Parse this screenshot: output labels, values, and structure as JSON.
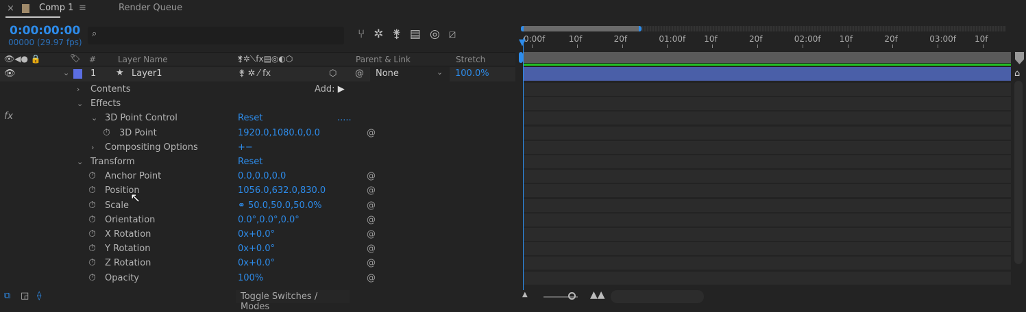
{
  "tabs": [
    {
      "label": "Comp 1",
      "close": "×",
      "menu": "≡",
      "swatch": "#a08a6a"
    },
    {
      "label": "Render Queue"
    }
  ],
  "timecode": "0:00:00:00",
  "frame_info": "00000 (29.97 fps)",
  "search": {
    "placeholder": ""
  },
  "columns": {
    "layer_name": "Layer Name",
    "num": "#",
    "parent": "Parent & Link",
    "stretch": "Stretch"
  },
  "layer": {
    "number": "1",
    "name": "Layer1",
    "color": "#5b6ee1",
    "parent": "None",
    "stretch": "100.0%"
  },
  "properties": [
    {
      "label": "Contents",
      "indent": 1,
      "chev": "›",
      "extra": "Add:"
    },
    {
      "label": "Effects",
      "indent": 1,
      "chev": "⌄"
    },
    {
      "label": "3D Point Control",
      "indent": 2,
      "chev": "⌄",
      "value": "Reset",
      "more": "....."
    },
    {
      "label": "3D Point",
      "indent": 3,
      "watch": true,
      "value": "1920.0,1080.0,0.0",
      "spiral": true
    },
    {
      "label": "Compositing Options",
      "indent": 2,
      "chev": "›",
      "value": "+−"
    },
    {
      "label": "Transform",
      "indent": 1,
      "chev": "⌄",
      "value": "Reset"
    },
    {
      "label": "Anchor Point",
      "indent": 2,
      "watch": true,
      "value": "0.0,0.0,0.0",
      "spiral": true
    },
    {
      "label": "Position",
      "indent": 2,
      "watch": true,
      "value": "1056.0,632.0,830.0",
      "spiral": true
    },
    {
      "label": "Scale",
      "indent": 2,
      "watch": true,
      "value": "⚭ 50.0,50.0,50.0%",
      "spiral": true
    },
    {
      "label": "Orientation",
      "indent": 2,
      "watch": true,
      "value": "0.0°,0.0°,0.0°",
      "spiral": true
    },
    {
      "label": "X Rotation",
      "indent": 2,
      "watch": true,
      "value": "0x+0.0°",
      "spiral": true
    },
    {
      "label": "Y Rotation",
      "indent": 2,
      "watch": true,
      "value": "0x+0.0°",
      "spiral": true
    },
    {
      "label": "Z Rotation",
      "indent": 2,
      "watch": true,
      "value": "0x+0.0°",
      "spiral": true
    },
    {
      "label": "Opacity",
      "indent": 2,
      "watch": true,
      "value": "100%",
      "spiral": true
    }
  ],
  "ruler_ticks": [
    "0:00f",
    "10f",
    "20f",
    "01:00f",
    "10f",
    "20f",
    "02:00f",
    "10f",
    "20f",
    "03:00f",
    "10f"
  ],
  "footer": {
    "toggle": "Toggle Switches / Modes"
  },
  "colors": {
    "accent": "#2d8ceb",
    "layer_bar": "#4a5fa8",
    "green": "#22c322"
  }
}
